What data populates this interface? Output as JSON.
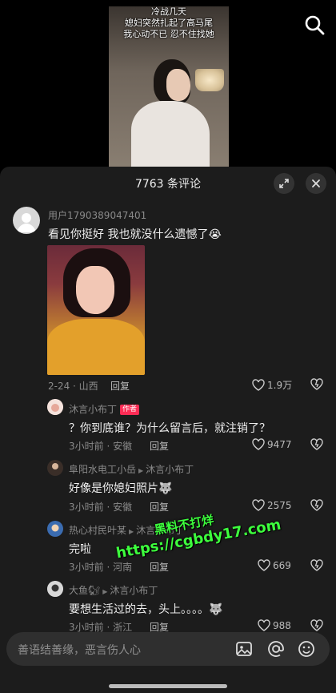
{
  "video": {
    "caption_lines": [
      "冷战几天",
      "媳妇突然扎起了高马尾",
      "我心动不已 忍不住找她"
    ]
  },
  "panel": {
    "title": "7763 条评论",
    "expand_icon": "expand-icon",
    "close_icon": "close-icon"
  },
  "comments": [
    {
      "username": "用户1790389047401",
      "text": "看见你挺好 我也就没什么遗憾了😭",
      "meta": "2-24 · 山西",
      "reply": "回复",
      "likes": "1.9万"
    },
    {
      "username": "沐言小布丁",
      "badge": "作者",
      "text": "？你到底谁？为什么留言后，就注销了？",
      "meta": "3小时前 · 安徽",
      "reply": "回复",
      "likes": "9477"
    },
    {
      "username": "阜阳水电工小岳",
      "reply_to": "沐言小布丁",
      "text": "好像是你媳妇照片🐺",
      "meta": "3小时前 · 安徽",
      "reply": "回复",
      "likes": "2575"
    },
    {
      "username": "热心村民叶某",
      "reply_to": "沐言小布丁",
      "text": "完啦",
      "meta": "3小时前 · 河南",
      "reply": "回复",
      "likes": "669"
    },
    {
      "username": "大鱼🐿",
      "reply_to": "沐言小布丁",
      "text": "要想生活过的去，头上。。。。🐺",
      "meta": "3小时前 · 浙江",
      "reply": "回复",
      "likes": "988"
    }
  ],
  "watermark": {
    "line1": "黑料不打烊",
    "line2": "https://cgbdy17.com"
  },
  "input": {
    "placeholder": "善语结善缘，恶言伤人心",
    "icons": [
      "image-icon",
      "mention-icon",
      "emoji-icon"
    ]
  },
  "colors": {
    "panel_bg": "#1c1c1c",
    "author_badge": "#fe2c55",
    "watermark": "#3dff3d"
  }
}
